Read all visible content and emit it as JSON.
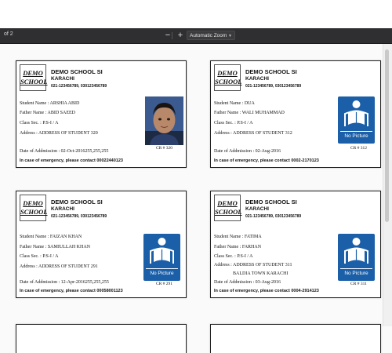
{
  "toolbar": {
    "page_count": "of 2",
    "zoom_out": "−",
    "zoom_in": "+",
    "zoom_value": "Automatic Zoom"
  },
  "no_picture_label": "No Picture",
  "cards": [
    {
      "school": "DEMO SCHOOL SI",
      "city": "KARACHI",
      "phone": "021-123456789, 030123456789",
      "logo_line1": "DEMO",
      "logo_line2": "SCHOOL",
      "student": "Student Name : ARSHIA ABID",
      "father": "Father Name   : ABID SAEED",
      "class": "Class Sec.   : P.S-I / A",
      "address": "Address :    ADDRESS OF STUDENT 320",
      "address2": "",
      "admission": "Date of Addmission : 02-Oct-2016255,255,255",
      "emergency": "In case of emergency, please contact 00022440123",
      "cr": "CR # 320",
      "photo": "child-photo"
    },
    {
      "school": "DEMO SCHOOL SI",
      "city": "KARACHI",
      "phone": "021-123456789, 030123456789",
      "logo_line1": "DEMO",
      "logo_line2": "SCHOOL",
      "student": "Student Name : DUA",
      "father": "Father Name : WALI MUHAMMAD",
      "class": "Class Sec.   : P.S-I / A",
      "address": "Address :    ADDRESS OF STUDENT 312",
      "address2": "",
      "admission": "Date of Addmission : 02-Aug-2016",
      "emergency": "In case of emergency, please contact 0002-2170123",
      "cr": "CR # 312",
      "photo": "no-picture"
    },
    {
      "school": "DEMO SCHOOL SI",
      "city": "KARACHI",
      "phone": "021-123456789, 030123456789",
      "logo_line1": "DEMO",
      "logo_line2": "SCHOOL",
      "student": "Student Name : FAIZAN KHAN",
      "father": "Father Name   : SAMIULLAH KHAN",
      "class": "Class Sec.   : P.S-I / A",
      "address": "Address :    ADDRESS OF STUDENT 291",
      "address2": "",
      "admission": "Date of Addmission : 12-Apr-2016255,255,255",
      "emergency": "In case of emergency, please contact 00058001123",
      "cr": "CR # 291",
      "photo": "no-picture"
    },
    {
      "school": "DEMO SCHOOL SI",
      "city": "KARACHI",
      "phone": "021-123456789, 030123456789",
      "logo_line1": "DEMO",
      "logo_line2": "SCHOOL",
      "student": "Student Name : FATIMA",
      "father": "Father Name   : FARHAN",
      "class": "Class Sec.   : P.S-I / A",
      "address": "Address :    ADDRESS OF STUDENT 311",
      "address2": "BALDIA TOWN KARACHI",
      "admission": "Date of Addmission : 03-Aug-2016",
      "emergency": "In case of emergency, please contact 0004-2914123",
      "cr": "CR # 311",
      "photo": "no-picture"
    }
  ]
}
